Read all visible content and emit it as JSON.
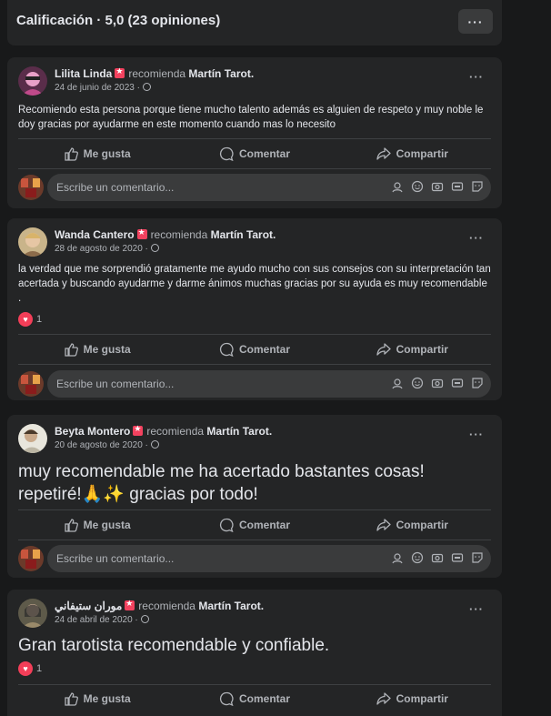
{
  "header": {
    "title": "Calificación · 5,0 (23 opiniones)",
    "more_label": "···"
  },
  "common": {
    "recommends": "recomienda",
    "page_name": "Martín Tarot.",
    "like": "Me gusta",
    "comment": "Comentar",
    "share": "Compartir",
    "comment_placeholder": "Escribe un comentario...",
    "more": "···"
  },
  "posts": [
    {
      "author": "Lilita Linda",
      "date": "24 de junio de 2023 ·",
      "text": "Recomiendo esta persona porque tiene mucho talento además es alguien de respeto y muy noble le doy gracias por ayudarme en este momento cuando mas lo necesito",
      "reactions": ""
    },
    {
      "author": "Wanda Cantero",
      "date": "28 de agosto de 2020 ·",
      "text": "la verdad que me sorprendió gratamente me ayudo mucho con sus consejos con su interpretación tan acertada y buscando ayudarme y darme ánimos muchas gracias por su ayuda es muy recomendable .",
      "reactions": "1"
    },
    {
      "author": "Beyta Montero",
      "date": "20 de agosto de 2020 ·",
      "text": "muy recomendable me ha acertado bastantes cosas! repetiré!🙏✨ gracias por todo!",
      "reactions": ""
    },
    {
      "author": "موران ستيفاني",
      "date": "24 de abril de 2020 ·",
      "text": "Gran tarotista recomendable y confiable.",
      "reactions": "1"
    }
  ],
  "colors": {
    "background": "#18191a",
    "card": "#242526",
    "input": "#3a3b3c",
    "recommend_badge": "#f3425f",
    "heart": "#f33e58"
  }
}
